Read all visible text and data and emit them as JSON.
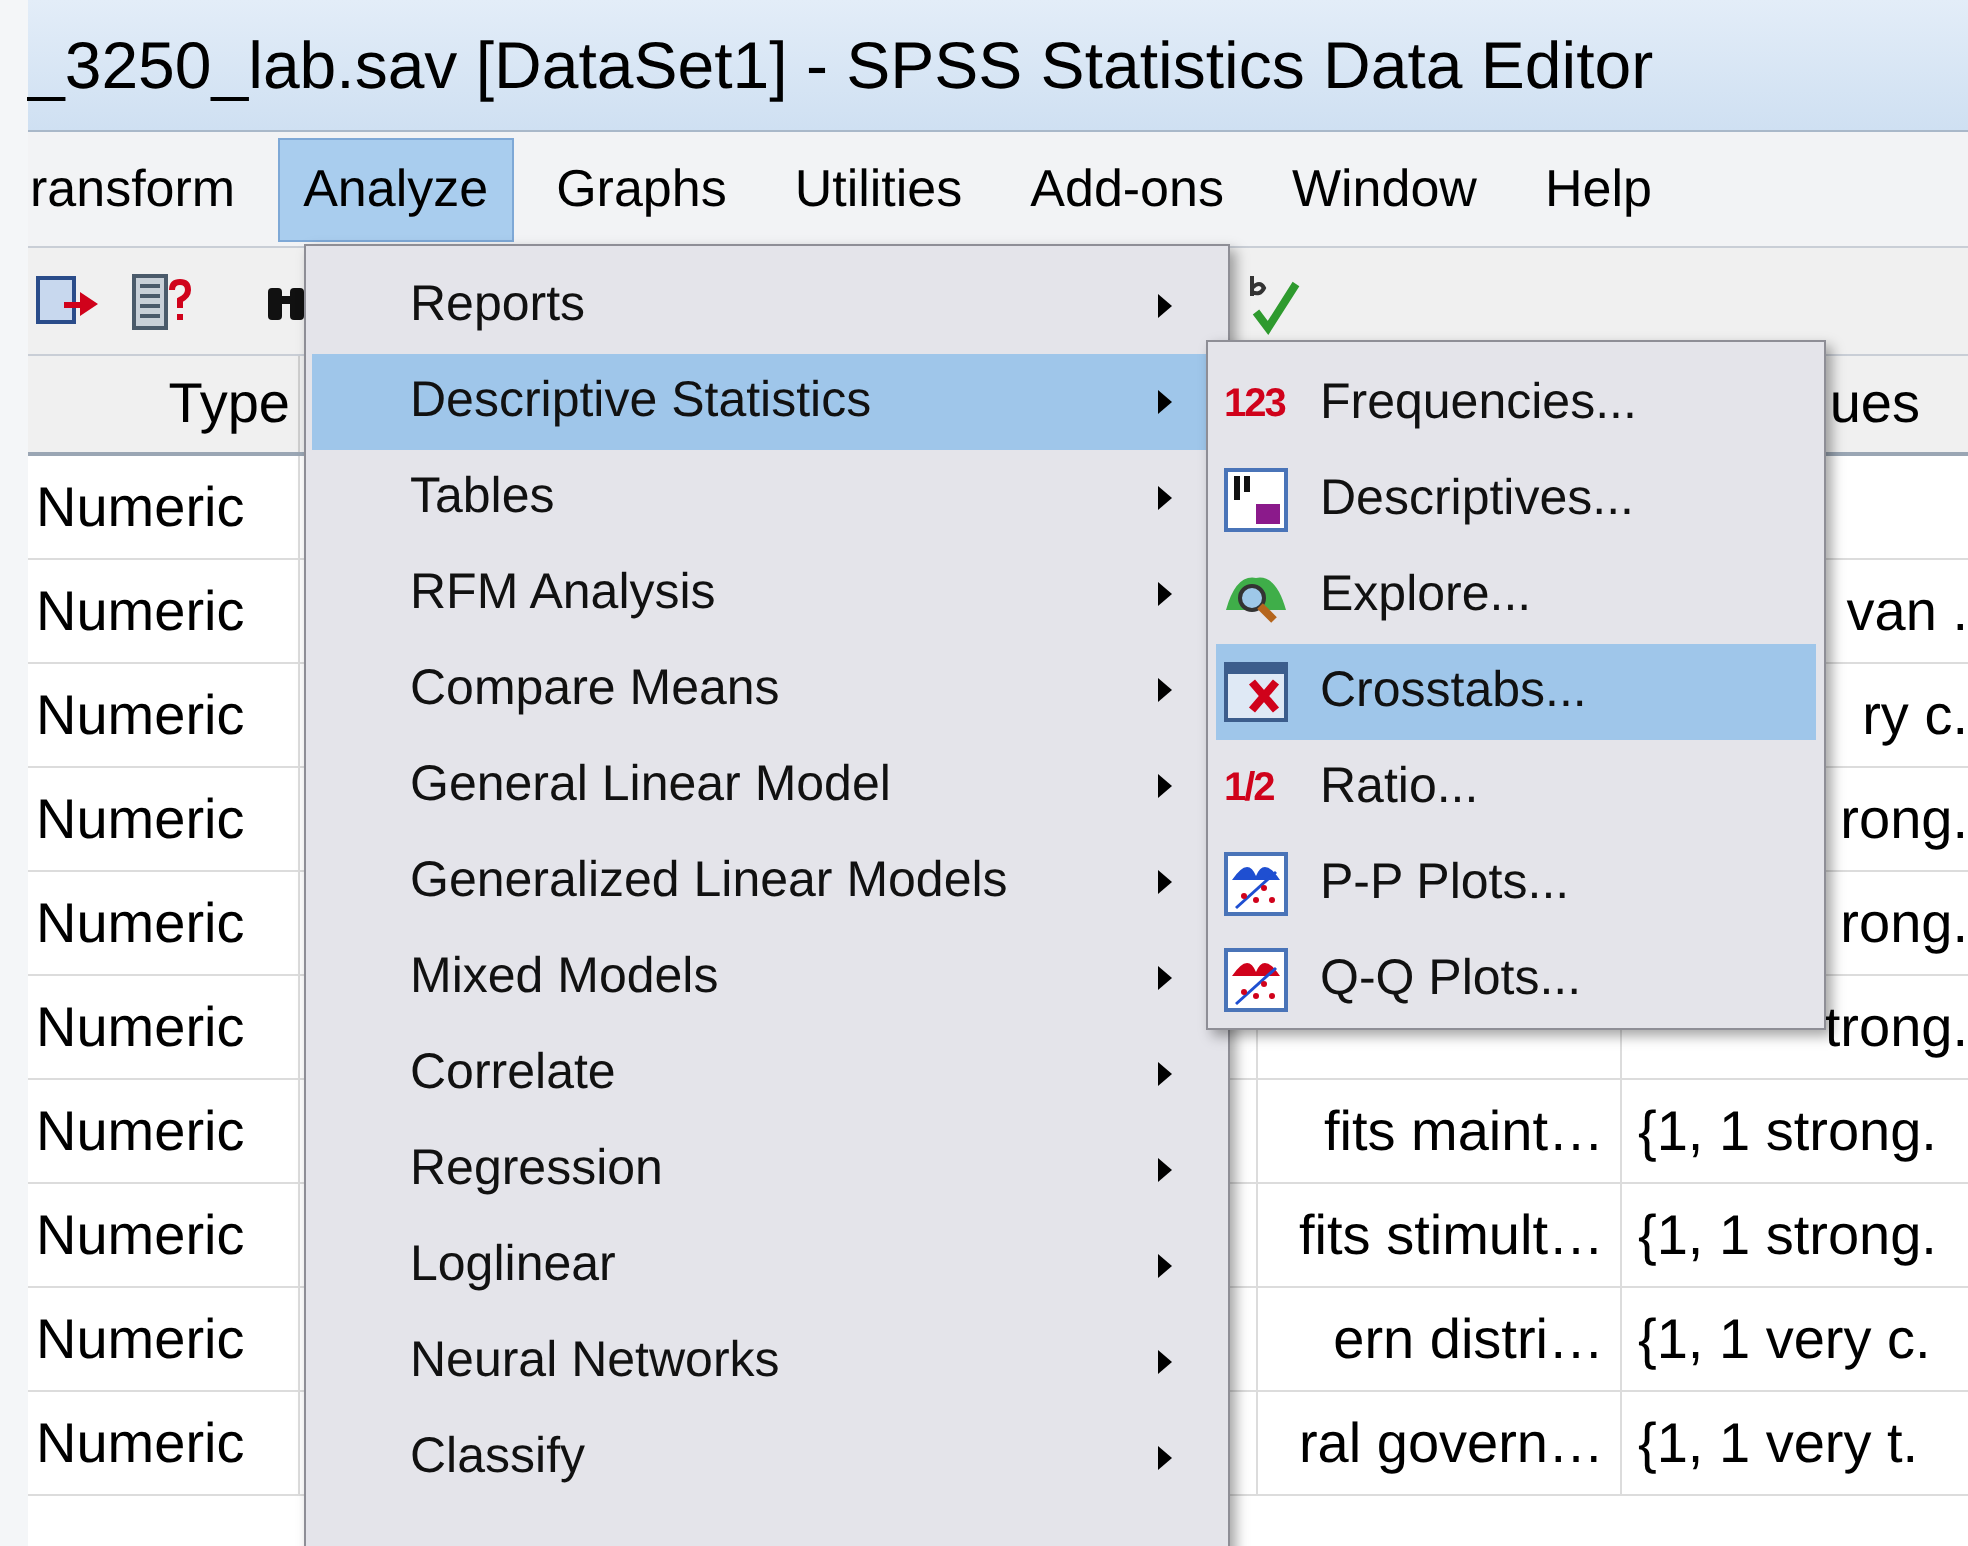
{
  "window": {
    "title": "_3250_lab.sav [DataSet1] - SPSS Statistics Data Editor"
  },
  "menu_bar": [
    {
      "label": "ransform",
      "selected": false
    },
    {
      "label": "Analyze",
      "selected": true
    },
    {
      "label": "Graphs",
      "selected": false
    },
    {
      "label": "Utilities",
      "selected": false
    },
    {
      "label": "Add-ons",
      "selected": false
    },
    {
      "label": "Window",
      "selected": false
    },
    {
      "label": "Help",
      "selected": false
    }
  ],
  "table": {
    "header": {
      "type": "Type",
      "values": "ues"
    },
    "rows": [
      {
        "type": "Numeric"
      },
      {
        "type": "Numeric",
        "values": "van ."
      },
      {
        "type": "Numeric",
        "values": "ry c."
      },
      {
        "type": "Numeric",
        "values": "rong."
      },
      {
        "type": "Numeric",
        "values": "rong."
      },
      {
        "type": "Numeric",
        "values": "trong."
      },
      {
        "type": "Numeric",
        "label": "fits maint…",
        "values": "{1, 1 strong."
      },
      {
        "type": "Numeric",
        "label": "fits stimult…",
        "values": "{1, 1 strong."
      },
      {
        "type": "Numeric",
        "label": "ern distri…",
        "values": "{1, 1 very c."
      },
      {
        "type": "Numeric",
        "label": "ral govern…",
        "values": "{1, 1 very t."
      }
    ]
  },
  "analyze_menu": [
    {
      "label": "Reports",
      "selected": false
    },
    {
      "label": "Descriptive Statistics",
      "selected": true
    },
    {
      "label": "Tables",
      "selected": false
    },
    {
      "label": "RFM Analysis",
      "selected": false
    },
    {
      "label": "Compare Means",
      "selected": false
    },
    {
      "label": "General Linear Model",
      "selected": false
    },
    {
      "label": "Generalized Linear Models",
      "selected": false
    },
    {
      "label": "Mixed Models",
      "selected": false
    },
    {
      "label": "Correlate",
      "selected": false
    },
    {
      "label": "Regression",
      "selected": false
    },
    {
      "label": "Loglinear",
      "selected": false
    },
    {
      "label": "Neural Networks",
      "selected": false
    },
    {
      "label": "Classify",
      "selected": false
    }
  ],
  "descriptive_statistics_menu": [
    {
      "label": "Frequencies...",
      "badge": "123",
      "selected": false
    },
    {
      "label": "Descriptives...",
      "selected": false
    },
    {
      "label": "Explore...",
      "selected": false
    },
    {
      "label": "Crosstabs...",
      "selected": true
    },
    {
      "label": "Ratio...",
      "badge": "1/2",
      "selected": false
    },
    {
      "label": "P-P Plots...",
      "selected": false
    },
    {
      "label": "Q-Q Plots...",
      "selected": false
    }
  ]
}
